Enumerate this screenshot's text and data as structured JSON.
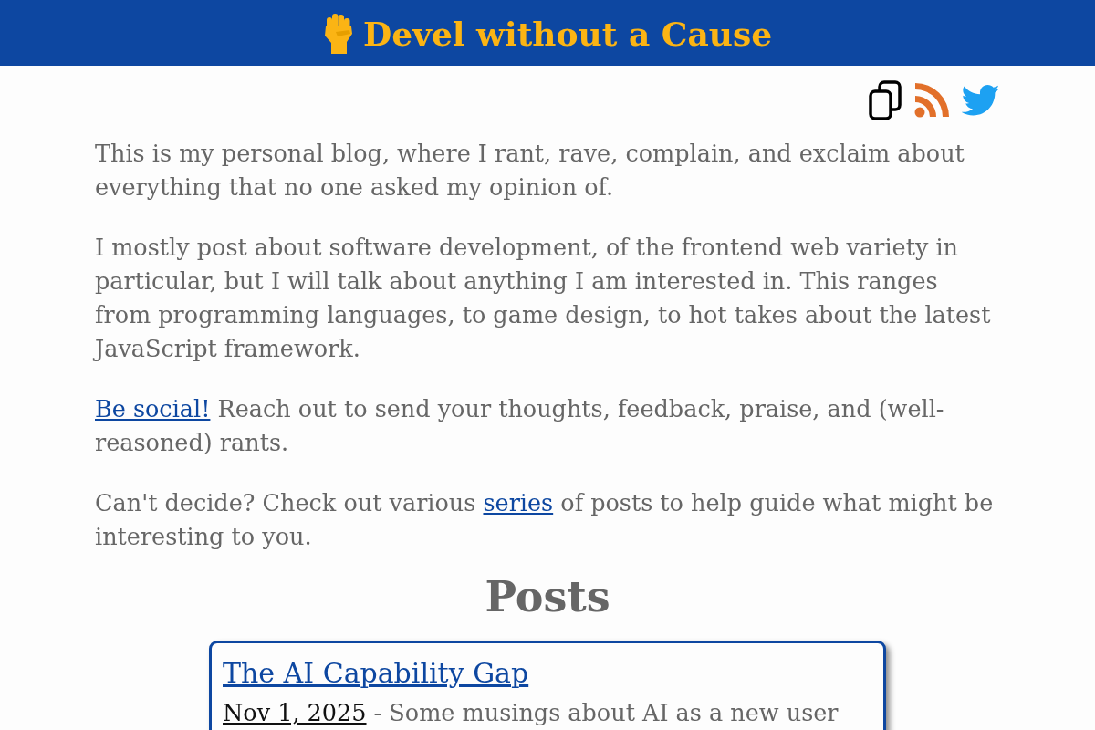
{
  "header": {
    "title": "Devel without a Cause"
  },
  "intro": {
    "paragraphs": [
      [
        {
          "kind": "text",
          "text": "This is my personal blog, where I rant, rave, complain, and exclaim about everything that no one asked my opinion of."
        }
      ],
      [
        {
          "kind": "text",
          "text": "I mostly post about software development, of the frontend web variety in particular, but I will talk about anything I am interested in. This ranges from programming languages, to game design, to hot takes about the latest JavaScript framework."
        }
      ],
      [
        {
          "kind": "link",
          "text": "Be social!"
        },
        {
          "kind": "text",
          "text": " Reach out to send your thoughts, feedback, praise, and (well-reasoned) rants."
        }
      ],
      [
        {
          "kind": "text",
          "text": "Can't decide? Check out various "
        },
        {
          "kind": "link",
          "text": "series"
        },
        {
          "kind": "text",
          "text": " of posts to help guide what might be interesting to you."
        }
      ]
    ]
  },
  "posts": {
    "heading": "Posts",
    "items": [
      {
        "title": "The AI Capability Gap",
        "date": "Nov 1, 2025",
        "summary": " - Some musings about AI as a new user"
      }
    ]
  }
}
